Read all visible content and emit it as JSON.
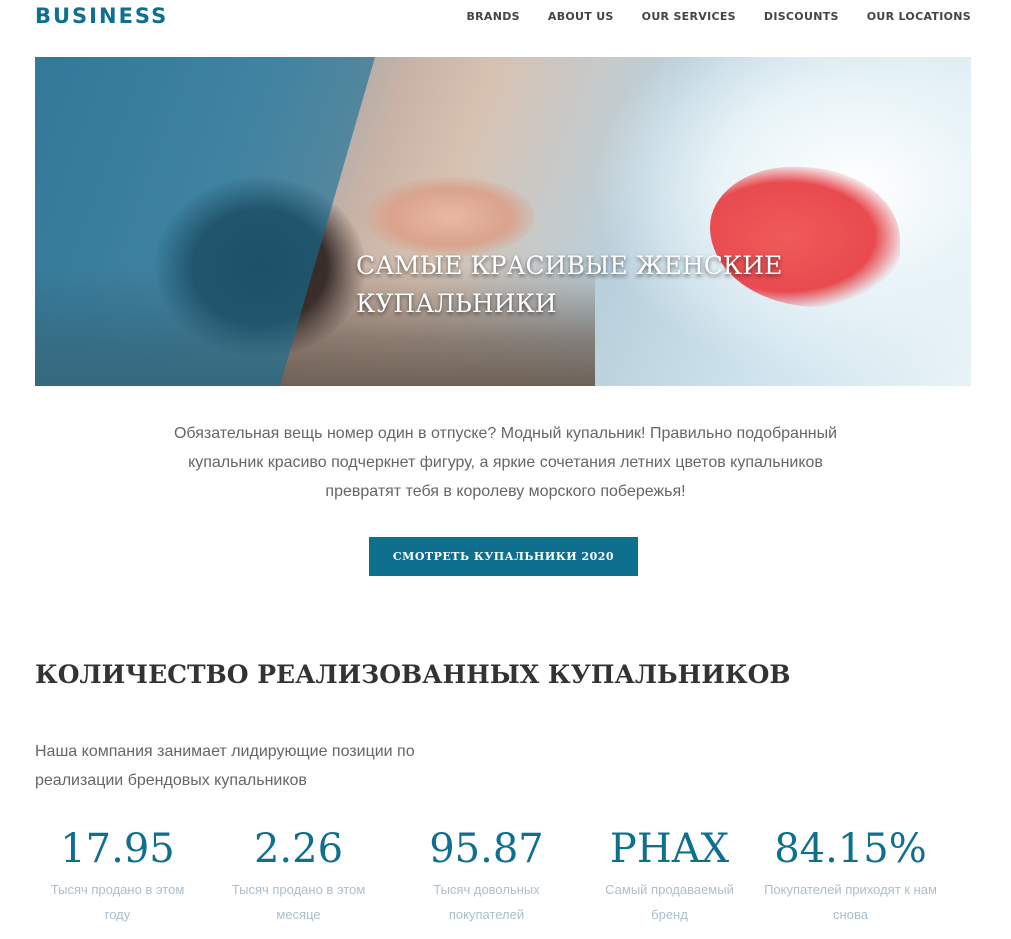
{
  "header": {
    "logo": "BUSINESS",
    "nav": [
      "BRANDS",
      "ABOUT US",
      "OUR SERVICES",
      "DISCOUNTS",
      "OUR LOCATIONS"
    ]
  },
  "hero": {
    "caption_line1": "САМЫЕ КРАСИВЫЕ ЖЕНСКИЕ",
    "caption_line2": "КУПАЛЬНИКИ"
  },
  "intro": {
    "lines": [
      "Обязательная вещь номер один в отпуске? Модный купальник! Правильно подобранный",
      "купальник красиво подчеркнет фигуру, а яркие сочетания летних цветов купальников",
      "превратят тебя в королеву морского побережья!"
    ]
  },
  "cta": {
    "label": "СМОТРЕТЬ КУПАЛЬНИКИ 2020"
  },
  "stats_section": {
    "title": "КОЛИЧЕСТВО РЕАЛИЗОВАННЫХ КУПАЛЬНИКОВ",
    "desc_line1": "Наша компания занимает лидирующие позиции по",
    "desc_line2": "реализации брендовых купальников",
    "items": [
      {
        "value": "17.95",
        "label_line1": "Тысяч продано в этом",
        "label_line2": "году"
      },
      {
        "value": "2.26",
        "label_line1": "Тысяч продано в этом",
        "label_line2": "месяце"
      },
      {
        "value": "95.87",
        "label_line1": "Тысяч довольных",
        "label_line2": "покупателей"
      },
      {
        "value": "PHAX",
        "label_line1": "Самый продаваемый",
        "label_line2": "бренд"
      },
      {
        "value": "84.15%",
        "label_line1": "Покупателей приходят к нам",
        "label_line2": "снова"
      }
    ]
  },
  "colors": {
    "accent": "#0e6f8f",
    "text": "#333333",
    "muted": "#666666",
    "label": "#aabfcc"
  }
}
